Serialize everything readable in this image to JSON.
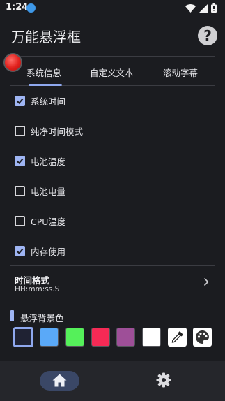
{
  "status_bar": {
    "time": "1:24"
  },
  "header": {
    "title": "万能悬浮框",
    "help_glyph": "?"
  },
  "tabs": [
    {
      "label": "系统信息",
      "selected": true
    },
    {
      "label": "自定义文本",
      "selected": false
    },
    {
      "label": "滚动字幕",
      "selected": false
    }
  ],
  "options": [
    {
      "label": "系统时间",
      "checked": true
    },
    {
      "label": "纯净时间模式",
      "checked": false
    },
    {
      "label": "电池温度",
      "checked": true
    },
    {
      "label": "电池电量",
      "checked": false
    },
    {
      "label": "CPU温度",
      "checked": false
    },
    {
      "label": "内存使用",
      "checked": true
    }
  ],
  "time_format": {
    "title": "时间格式",
    "value": "HH:mm:ss.S"
  },
  "background": {
    "label": "悬浮背景色",
    "swatches": [
      "#1f2233",
      "#5aa9f8",
      "#55f05a",
      "#f52a55",
      "#9e4f98",
      "#ffffff"
    ],
    "selected_index": 0,
    "tools": [
      "eyedropper-icon",
      "palette-icon"
    ]
  },
  "colors": {
    "accent": "#9fb5f3",
    "background": "#1b1c20",
    "nav_active": "#3a4766"
  },
  "bottom_nav": {
    "items": [
      "home-icon",
      "gear-icon"
    ],
    "active": "home-icon"
  }
}
